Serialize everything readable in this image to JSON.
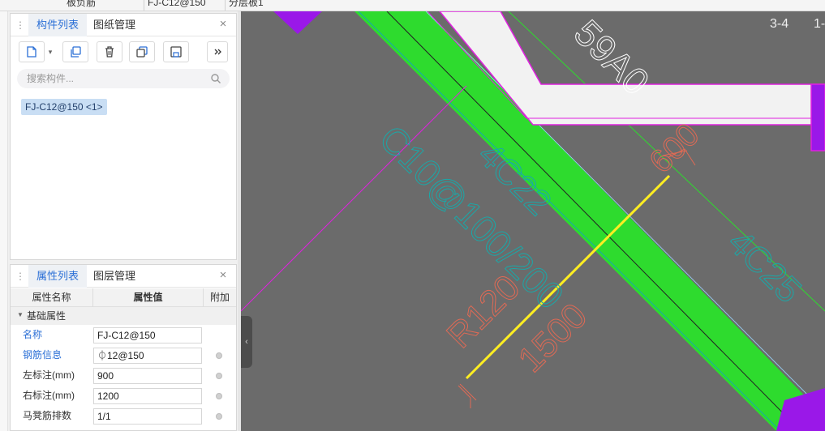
{
  "topbar": {
    "cells": [
      "板负筋",
      "FJ-C12@150",
      "分层板1"
    ]
  },
  "component_panel": {
    "tabs": [
      "构件列表",
      "图纸管理"
    ],
    "active_tab": "构件列表",
    "search_placeholder": "搜索构件...",
    "selected_item": "FJ-C12@150 <1>",
    "toolbar_icons": [
      "new-icon",
      "copy-icon",
      "delete-icon",
      "layer-copy-icon",
      "save-icon",
      "more-icon"
    ]
  },
  "property_panel": {
    "tabs": [
      "属性列表",
      "图层管理"
    ],
    "active_tab": "属性列表",
    "columns": [
      "属性名称",
      "属性值",
      "附加"
    ],
    "group": "基础属性",
    "rows": [
      {
        "name": "名称",
        "value": "FJ-C12@150",
        "link": true,
        "has_dot": false
      },
      {
        "name": "钢筋信息",
        "value": "⏀12@150",
        "link": true,
        "has_dot": true
      },
      {
        "name": "左标注(mm)",
        "value": "900",
        "link": false,
        "has_dot": true
      },
      {
        "name": "右标注(mm)",
        "value": "1200",
        "link": false,
        "has_dot": true
      },
      {
        "name": "马凳筋排数",
        "value": "1/1",
        "link": false,
        "has_dot": true
      }
    ]
  },
  "canvas": {
    "labels": {
      "grid_a": "3-4",
      "grid_b": "1-",
      "dim_600": "600",
      "dim_1500": "1500",
      "rebar_a": "4C22",
      "rebar_b": "C10@100/200",
      "radius": "R120",
      "rebar_c": "4C25",
      "cad_text": "59A0"
    },
    "colors": {
      "background": "#6b6b6b",
      "beam": "#2edb2e",
      "magenta": "#e020e0",
      "yellow": "#ffee22",
      "dim_red": "#e06a55",
      "cyan_text": "#1aa8a8",
      "purple": "#9a18e8"
    }
  }
}
